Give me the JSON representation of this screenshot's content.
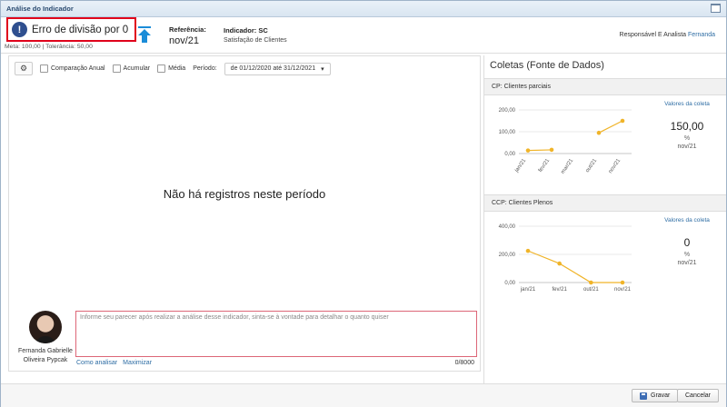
{
  "window": {
    "title": "Análise do Indicador"
  },
  "header": {
    "error_message": "Erro de divisão por 0",
    "meta_line": "Meta: 100,00 | Tolerância: 50,00",
    "referencia_label": "Referência:",
    "referencia_value": "nov/21",
    "indicador_label": "Indicador: SC",
    "indicador_name": "Satisfação de Clientes",
    "responsavel_prefix": "Responsável E Analista",
    "responsavel_name": "Fernanda"
  },
  "toolbar": {
    "comparacao_anual": "Comparação Anual",
    "acumular": "Acumular",
    "media": "Média",
    "periodo_label": "Período:",
    "periodo_value": "de 01/12/2020 até 31/12/2021"
  },
  "main": {
    "empty_message": "Não há registros neste período"
  },
  "analyst": {
    "name_line1": "Fernanda Gabrielle",
    "name_line2": "Oliveira Pypcak",
    "comment_placeholder": "Informe seu parecer após realizar a análise desse indicador, sinta-se à vontade para detalhar o quanto quiser",
    "link_como_analisar": "Como analisar",
    "link_maximizar": "Maximizar",
    "char_counter": "0/8000"
  },
  "coletas": {
    "title": "Coletas (Fonte de Dados)",
    "cards": [
      {
        "title": "CP: Clientes parciais",
        "link": "Valores da coleta",
        "value": "150,00",
        "unit": "%",
        "date": "nov/21"
      },
      {
        "title": "CCP: Clientes Plenos",
        "link": "Valores da coleta",
        "value": "0",
        "unit": "%",
        "date": "nov/21"
      }
    ]
  },
  "chart_data": [
    {
      "type": "line",
      "categories": [
        "jan/21",
        "fev/21",
        "mar/21",
        "out/21",
        "nov/21"
      ],
      "series": [
        {
          "segments": [
            [
              [
                "jan/21",
                14
              ],
              [
                "fev/21",
                17
              ]
            ],
            [
              [
                "out/21",
                95
              ],
              [
                "nov/21",
                150
              ]
            ]
          ]
        }
      ],
      "ylim": [
        0,
        200
      ],
      "yticks": [
        "0,00",
        "100,00",
        "200,00"
      ],
      "color": "#f0b429"
    },
    {
      "type": "line",
      "categories": [
        "jan/21",
        "fev/21",
        "out/21",
        "nov/21"
      ],
      "series": [
        {
          "segments": [
            [
              [
                "jan/21",
                225
              ],
              [
                "fev/21",
                135
              ],
              [
                "out/21",
                0
              ],
              [
                "nov/21",
                0
              ]
            ]
          ]
        }
      ],
      "ylim": [
        0,
        400
      ],
      "yticks": [
        "0,00",
        "200,00",
        "400,00"
      ],
      "color": "#f0b429"
    }
  ],
  "footer": {
    "save_label": "Gravar",
    "cancel_label": "Cancelar"
  },
  "colors": {
    "error_border": "#e0001b",
    "accent": "#2e6da4",
    "series": "#f0b429"
  }
}
